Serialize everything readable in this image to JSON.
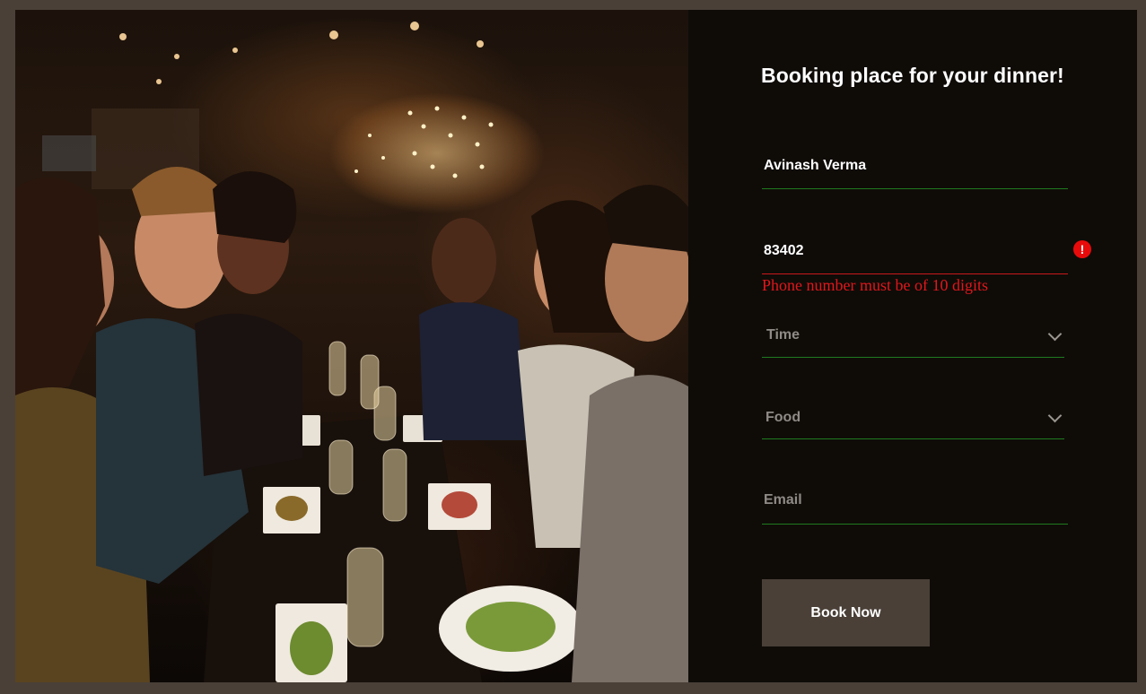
{
  "form": {
    "title": "Booking place for your dinner!",
    "name": {
      "value": "Avinash Verma"
    },
    "phone": {
      "value": "83402",
      "error": "Phone number must be of 10 digits",
      "error_icon": "!"
    },
    "time": {
      "placeholder": "Time"
    },
    "food": {
      "placeholder": "Food"
    },
    "email": {
      "placeholder": "Email"
    },
    "submit_label": "Book Now"
  },
  "image": {
    "subject": "friends-dining-at-restaurant-photo"
  },
  "colors": {
    "background": "#4a4038",
    "panel": "#0f0c08",
    "underline": "#1f7a1f",
    "error": "#e3161b",
    "button": "#4a4038"
  }
}
